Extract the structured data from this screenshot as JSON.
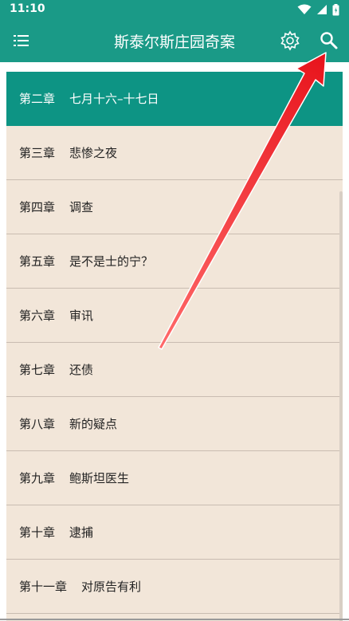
{
  "status_bar": {
    "time": "11:10"
  },
  "app_bar": {
    "title": "斯泰尔斯庄园奇案",
    "menu_icon": "menu-icon",
    "settings_icon": "gear-icon",
    "search_icon": "search-icon"
  },
  "chapters": [
    {
      "num": "第二章",
      "title": "七月十六–十七日",
      "active": true
    },
    {
      "num": "第三章",
      "title": "悲惨之夜"
    },
    {
      "num": "第四章",
      "title": "调查"
    },
    {
      "num": "第五章",
      "title": "是不是士的宁？"
    },
    {
      "num": "第六章",
      "title": "审讯"
    },
    {
      "num": "第七章",
      "title": "还债"
    },
    {
      "num": "第八章",
      "title": "新的疑点"
    },
    {
      "num": "第九章",
      "title": "鲍斯坦医生"
    },
    {
      "num": "第十章",
      "title": "逮捕"
    },
    {
      "num": "第十一章",
      "title": "对原告有利"
    }
  ],
  "colors": {
    "app_bar": "#1a9a87",
    "active_row": "#0d9484",
    "list_background": "#f2e6d9",
    "annotation_arrow": "#e8141c"
  }
}
